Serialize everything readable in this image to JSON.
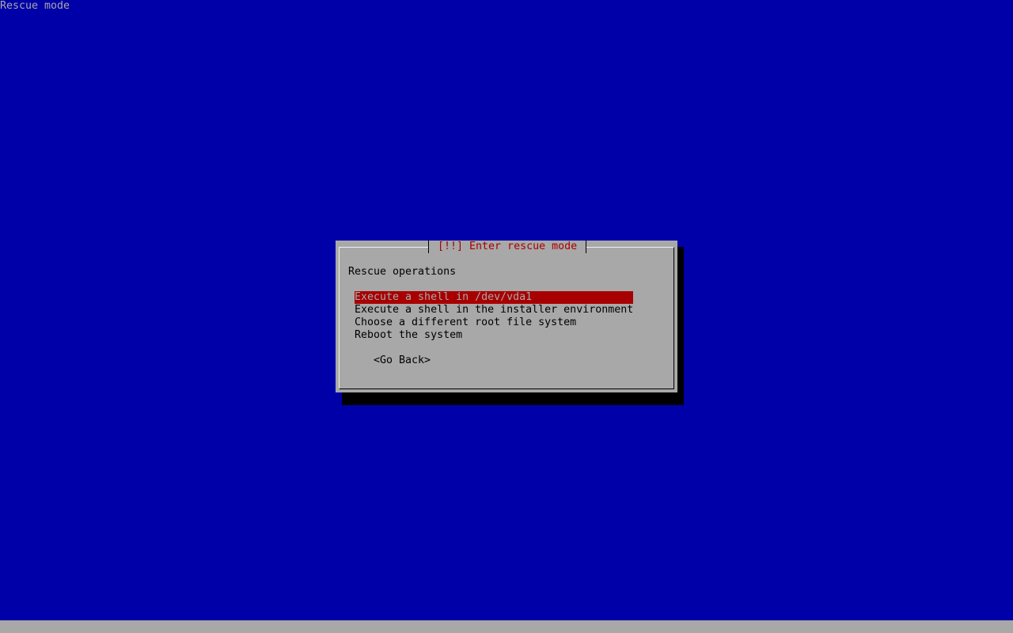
{
  "screen": {
    "title": "Rescue mode"
  },
  "dialog": {
    "title": "[!!] Enter rescue mode",
    "prompt": "Rescue operations",
    "menu_items": [
      "Execute a shell in /dev/vda1",
      "Execute a shell in the installer environment",
      "Choose a different root file system",
      "Reboot the system"
    ],
    "selected_index": 0,
    "go_back_label": "<Go Back>"
  },
  "status_bar": {
    "text": ""
  },
  "colors": {
    "background": "#0000a8",
    "dialog": "#a8a8a8",
    "accent_red": "#a80000",
    "shadow": "#000000"
  }
}
